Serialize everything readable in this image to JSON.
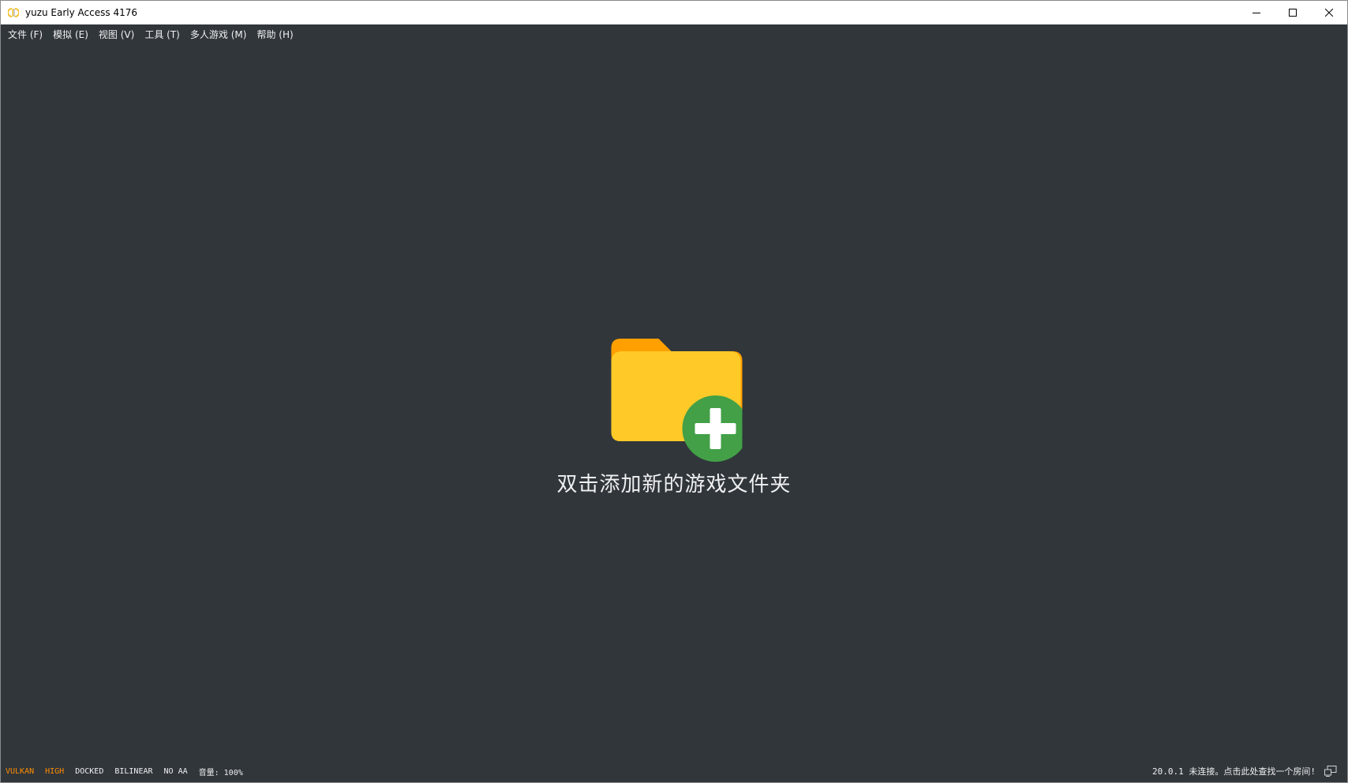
{
  "window": {
    "title": "yuzu Early Access 4176",
    "app_icon": "yuzu-logo-icon",
    "controls": [
      "minimize-icon",
      "maximize-icon",
      "close-icon"
    ]
  },
  "menubar": {
    "items": [
      {
        "label": "文件",
        "mnemonic": "(F)"
      },
      {
        "label": "模拟",
        "mnemonic": "(E)"
      },
      {
        "label": "视图",
        "mnemonic": "(V)"
      },
      {
        "label": "工具",
        "mnemonic": "(T)"
      },
      {
        "label": "多人游戏",
        "mnemonic": "(M)"
      },
      {
        "label": "帮助",
        "mnemonic": "(H)"
      }
    ]
  },
  "main": {
    "add_folder_icon": "folder-add-icon",
    "add_folder_label": "双击添加新的游戏文件夹"
  },
  "statusbar": {
    "items": [
      {
        "label": "VULKAN",
        "color": "#ff8c00"
      },
      {
        "label": "HIGH",
        "color": "#ff8c00"
      },
      {
        "label": "DOCKED",
        "color": "#eff0f1"
      },
      {
        "label": "BILINEAR",
        "color": "#eff0f1"
      },
      {
        "label": "NO AA",
        "color": "#eff0f1"
      },
      {
        "label": "音量: 100%",
        "color": "#eff0f1"
      }
    ],
    "version": "20.0.1",
    "network_status": "未连接。点击此处查找一个房间!",
    "network_icon": "network-disconnected-icon"
  },
  "colors": {
    "background": "#31363b",
    "text": "#eff0f1",
    "accent_orange": "#ff8c00",
    "folder_yellow": "#ffca28",
    "folder_tab": "#ffa000",
    "plus_green": "#43a047"
  }
}
